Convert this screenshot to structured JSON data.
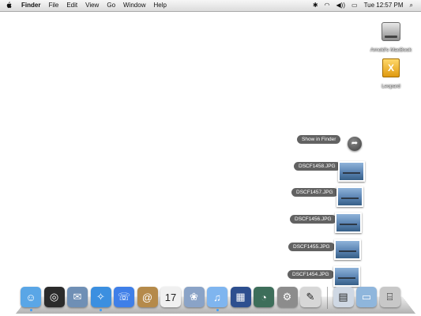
{
  "menubar": {
    "apple": "",
    "app_name": "Finder",
    "items": [
      "File",
      "Edit",
      "View",
      "Go",
      "Window",
      "Help"
    ],
    "status": {
      "bluetooth": "✱",
      "wifi": "◠",
      "volume": "◀))",
      "battery": "▭",
      "clock": "Tue 12:57 PM",
      "spotlight": "⌕"
    }
  },
  "desktop": {
    "icons": [
      {
        "label": "Arnold's MacBook",
        "icon": "hard-drive-icon"
      },
      {
        "label": "Leopard",
        "icon": "install-disk-icon"
      }
    ]
  },
  "stack": {
    "show_in_finder": "Show in Finder",
    "show_icon": "➦",
    "items": [
      {
        "label": "DSCF1458.JPG"
      },
      {
        "label": "DSCF1457.JPG"
      },
      {
        "label": "DSCF1456.JPG"
      },
      {
        "label": "DSCF1455.JPG"
      },
      {
        "label": "DSCF1454.JPG"
      }
    ]
  },
  "dock": {
    "apps": [
      {
        "name": "finder-icon",
        "glyph": "☺",
        "bg": "#5aa6e6",
        "running": true
      },
      {
        "name": "dashboard-icon",
        "glyph": "◎",
        "bg": "#2b2b2b",
        "running": false
      },
      {
        "name": "mail-icon",
        "glyph": "✉",
        "bg": "#6f8fb5",
        "running": false
      },
      {
        "name": "safari-icon",
        "glyph": "✧",
        "bg": "#3b8fe0",
        "running": true
      },
      {
        "name": "ichat-icon",
        "glyph": "☏",
        "bg": "#3f7fe8",
        "running": false
      },
      {
        "name": "address-book-icon",
        "glyph": "@",
        "bg": "#b58a4a",
        "running": false
      },
      {
        "name": "ical-icon",
        "glyph": "17",
        "bg": "#f0f0f0",
        "running": false
      },
      {
        "name": "iphoto-icon",
        "glyph": "❀",
        "bg": "#8aa3c7",
        "running": false
      },
      {
        "name": "itunes-icon",
        "glyph": "♫",
        "bg": "#7fb5ef",
        "running": true
      },
      {
        "name": "spaces-icon",
        "glyph": "▦",
        "bg": "#2d4f8f",
        "running": false
      },
      {
        "name": "time-machine-icon",
        "glyph": "◔",
        "bg": "#3d6e5a",
        "running": false
      },
      {
        "name": "system-preferences-icon",
        "glyph": "⚙",
        "bg": "#8c8c8c",
        "running": false
      },
      {
        "name": "preview-icon",
        "glyph": "✎",
        "bg": "#d7d7d7",
        "running": false
      }
    ],
    "right": [
      {
        "name": "photos-stack-icon",
        "glyph": "▤",
        "bg": "#cfd8e4",
        "running": false
      },
      {
        "name": "documents-folder-icon",
        "glyph": "▭",
        "bg": "#8fb6dc",
        "running": false
      },
      {
        "name": "trash-icon",
        "glyph": "⌸",
        "bg": "#c8c8c8",
        "running": false
      }
    ]
  }
}
